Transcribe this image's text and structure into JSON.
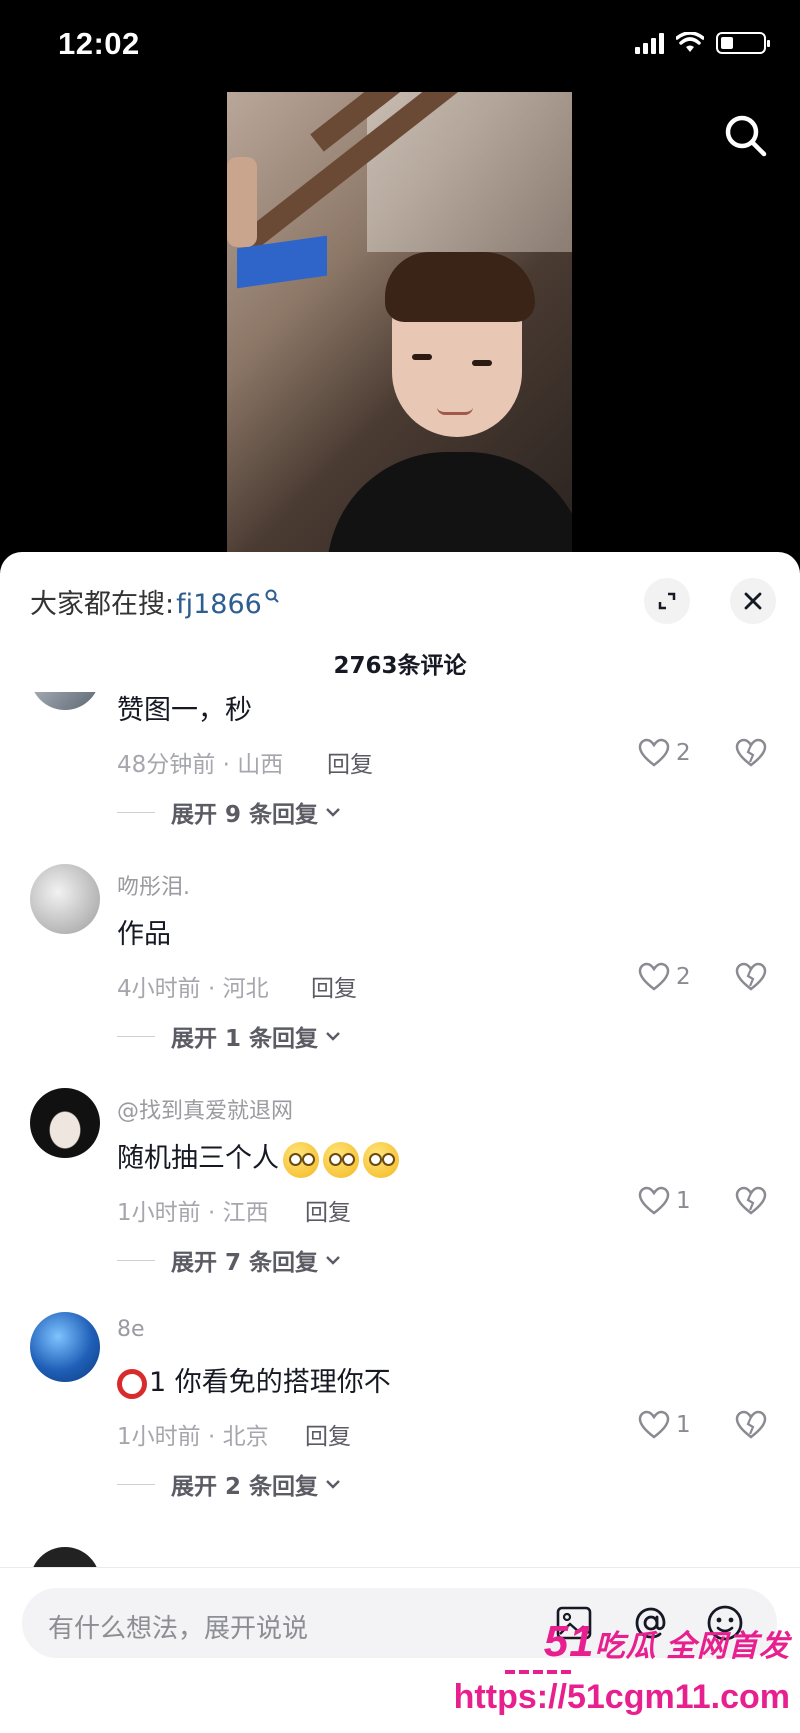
{
  "status_bar": {
    "time": "12:02",
    "battery_level": 0.3
  },
  "header": {
    "search_icon": "search-icon"
  },
  "panel": {
    "search_suggest_label": "大家都在搜:",
    "search_suggest_keyword": "fj1866",
    "comment_count": "2763条评论"
  },
  "comments": [
    {
      "user": "",
      "text": "赞图一，秒",
      "time_loc": "48分钟前 · 山西",
      "reply": "回复",
      "likes": "2",
      "expand": "展开 9 条回复"
    },
    {
      "user": "吻彤泪.",
      "text": "作品",
      "time_loc": "4小时前 · 河北",
      "reply": "回复",
      "likes": "2",
      "expand": "展开 1 条回复"
    },
    {
      "user": "@找到真爱就退网",
      "text": "随机抽三个人",
      "time_loc": "1小时前 · 江西",
      "reply": "回复",
      "likes": "1",
      "expand": "展开 7 条回复"
    },
    {
      "user": "8e",
      "text": "1 你看免的搭理你不",
      "time_loc": "1小时前 · 北京",
      "reply": "回复",
      "likes": "1",
      "expand": "展开 2 条回复"
    }
  ],
  "input": {
    "placeholder": "有什么想法，展开说说"
  },
  "watermark": {
    "brand_num": "51",
    "brand_text": "吃瓜 全网首发",
    "url": "https://51cgm11.com"
  },
  "colors": {
    "keyword": "#2e5e8f",
    "watermark": "#e8208f",
    "accent_red": "#d92b2b"
  }
}
